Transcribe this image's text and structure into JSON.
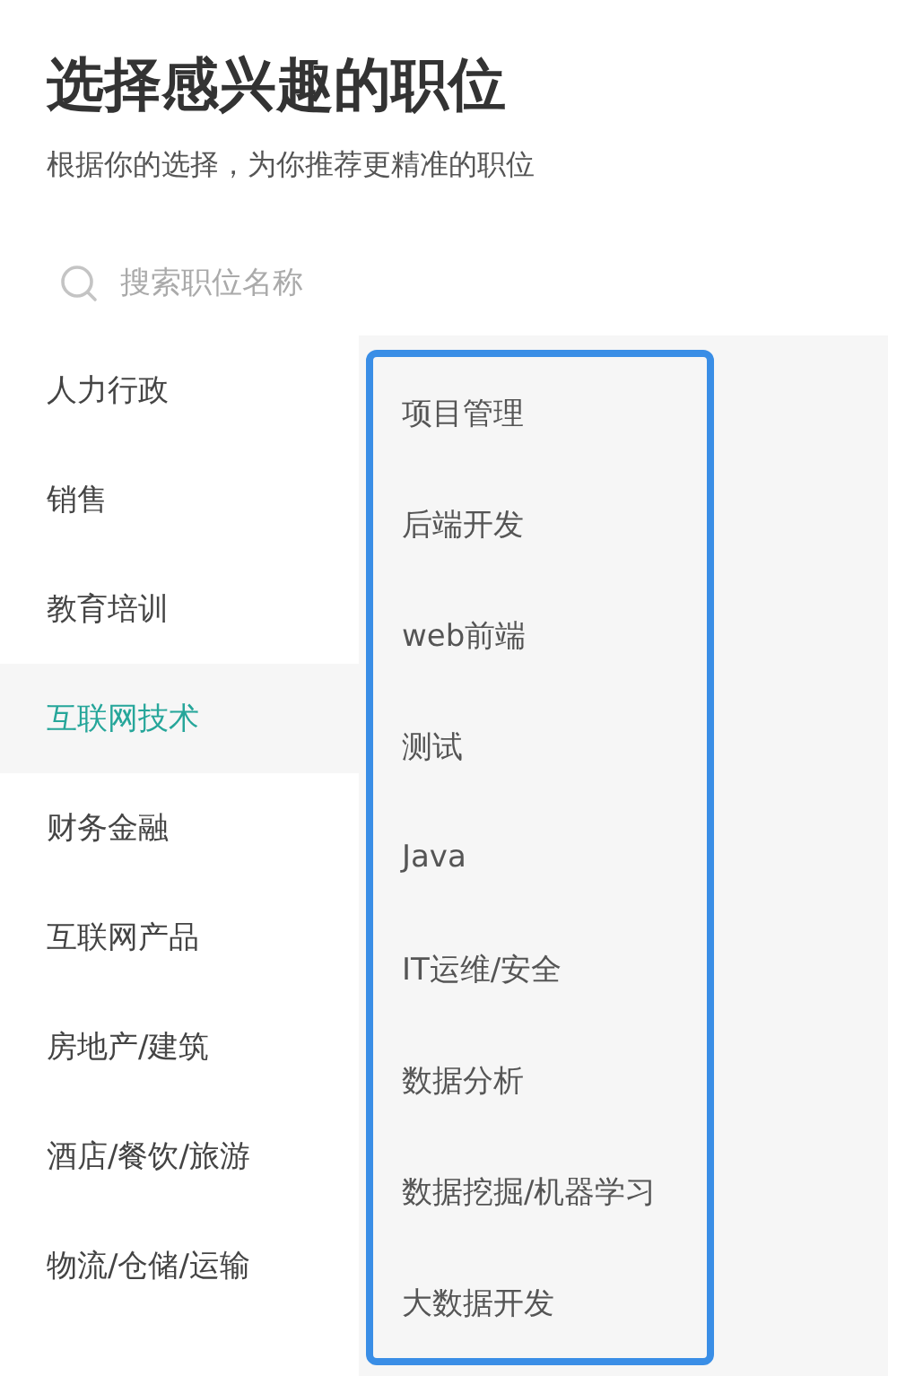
{
  "title": "选择感兴趣的职位",
  "subtitle": "根据你的选择，为你推荐更精准的职位",
  "search": {
    "placeholder": "搜索职位名称"
  },
  "categories": [
    {
      "label": "人力行政",
      "selected": false
    },
    {
      "label": "销售",
      "selected": false
    },
    {
      "label": "教育培训",
      "selected": false
    },
    {
      "label": "互联网技术",
      "selected": true
    },
    {
      "label": "财务金融",
      "selected": false
    },
    {
      "label": "互联网产品",
      "selected": false
    },
    {
      "label": "房地产/建筑",
      "selected": false
    },
    {
      "label": "酒店/餐饮/旅游",
      "selected": false
    },
    {
      "label": "物流/仓储/运输",
      "selected": false
    }
  ],
  "positions": [
    "项目管理",
    "后端开发",
    "web前端",
    "测试",
    "Java",
    "IT运维/安全",
    "数据分析",
    "数据挖掘/机器学习",
    "大数据开发"
  ]
}
